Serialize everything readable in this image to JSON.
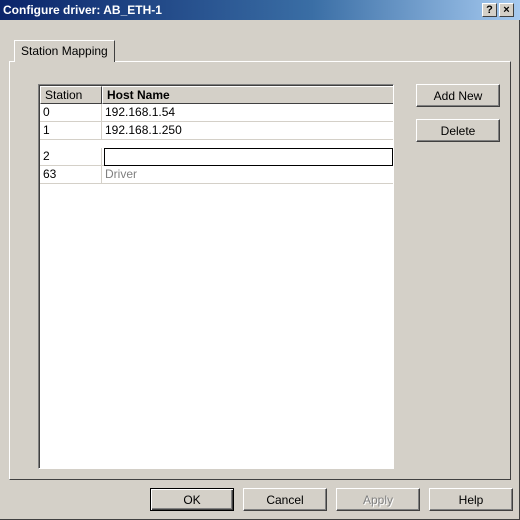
{
  "dialog": {
    "title": "Configure driver: AB_ETH-1",
    "help_button": "?",
    "close_button": "×"
  },
  "tabs": [
    {
      "label": "Station Mapping"
    }
  ],
  "table": {
    "columns": [
      "Station",
      "Host Name"
    ],
    "rows": [
      {
        "station": "0",
        "host": "192.168.1.54"
      },
      {
        "station": "1",
        "host": "192.168.1.250"
      },
      {
        "station": "2",
        "host": ""
      },
      {
        "station": "63",
        "host": "Driver"
      }
    ]
  },
  "side_buttons": {
    "add_new": "Add New",
    "delete": "Delete"
  },
  "footer_buttons": {
    "ok": "OK",
    "cancel": "Cancel",
    "apply": "Apply",
    "help": "Help"
  }
}
